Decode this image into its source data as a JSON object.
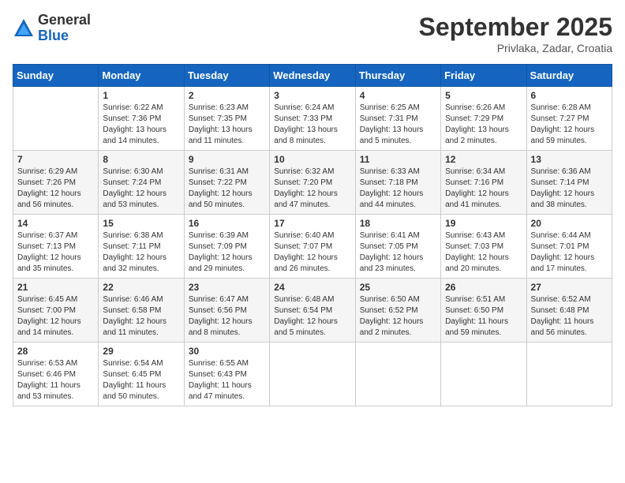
{
  "header": {
    "logo_general": "General",
    "logo_blue": "Blue",
    "month_title": "September 2025",
    "location": "Privlaka, Zadar, Croatia"
  },
  "weekdays": [
    "Sunday",
    "Monday",
    "Tuesday",
    "Wednesday",
    "Thursday",
    "Friday",
    "Saturday"
  ],
  "weeks": [
    [
      {
        "day": "",
        "sunrise": "",
        "sunset": "",
        "daylight": ""
      },
      {
        "day": "1",
        "sunrise": "Sunrise: 6:22 AM",
        "sunset": "Sunset: 7:36 PM",
        "daylight": "Daylight: 13 hours and 14 minutes."
      },
      {
        "day": "2",
        "sunrise": "Sunrise: 6:23 AM",
        "sunset": "Sunset: 7:35 PM",
        "daylight": "Daylight: 13 hours and 11 minutes."
      },
      {
        "day": "3",
        "sunrise": "Sunrise: 6:24 AM",
        "sunset": "Sunset: 7:33 PM",
        "daylight": "Daylight: 13 hours and 8 minutes."
      },
      {
        "day": "4",
        "sunrise": "Sunrise: 6:25 AM",
        "sunset": "Sunset: 7:31 PM",
        "daylight": "Daylight: 13 hours and 5 minutes."
      },
      {
        "day": "5",
        "sunrise": "Sunrise: 6:26 AM",
        "sunset": "Sunset: 7:29 PM",
        "daylight": "Daylight: 13 hours and 2 minutes."
      },
      {
        "day": "6",
        "sunrise": "Sunrise: 6:28 AM",
        "sunset": "Sunset: 7:27 PM",
        "daylight": "Daylight: 12 hours and 59 minutes."
      }
    ],
    [
      {
        "day": "7",
        "sunrise": "Sunrise: 6:29 AM",
        "sunset": "Sunset: 7:26 PM",
        "daylight": "Daylight: 12 hours and 56 minutes."
      },
      {
        "day": "8",
        "sunrise": "Sunrise: 6:30 AM",
        "sunset": "Sunset: 7:24 PM",
        "daylight": "Daylight: 12 hours and 53 minutes."
      },
      {
        "day": "9",
        "sunrise": "Sunrise: 6:31 AM",
        "sunset": "Sunset: 7:22 PM",
        "daylight": "Daylight: 12 hours and 50 minutes."
      },
      {
        "day": "10",
        "sunrise": "Sunrise: 6:32 AM",
        "sunset": "Sunset: 7:20 PM",
        "daylight": "Daylight: 12 hours and 47 minutes."
      },
      {
        "day": "11",
        "sunrise": "Sunrise: 6:33 AM",
        "sunset": "Sunset: 7:18 PM",
        "daylight": "Daylight: 12 hours and 44 minutes."
      },
      {
        "day": "12",
        "sunrise": "Sunrise: 6:34 AM",
        "sunset": "Sunset: 7:16 PM",
        "daylight": "Daylight: 12 hours and 41 minutes."
      },
      {
        "day": "13",
        "sunrise": "Sunrise: 6:36 AM",
        "sunset": "Sunset: 7:14 PM",
        "daylight": "Daylight: 12 hours and 38 minutes."
      }
    ],
    [
      {
        "day": "14",
        "sunrise": "Sunrise: 6:37 AM",
        "sunset": "Sunset: 7:13 PM",
        "daylight": "Daylight: 12 hours and 35 minutes."
      },
      {
        "day": "15",
        "sunrise": "Sunrise: 6:38 AM",
        "sunset": "Sunset: 7:11 PM",
        "daylight": "Daylight: 12 hours and 32 minutes."
      },
      {
        "day": "16",
        "sunrise": "Sunrise: 6:39 AM",
        "sunset": "Sunset: 7:09 PM",
        "daylight": "Daylight: 12 hours and 29 minutes."
      },
      {
        "day": "17",
        "sunrise": "Sunrise: 6:40 AM",
        "sunset": "Sunset: 7:07 PM",
        "daylight": "Daylight: 12 hours and 26 minutes."
      },
      {
        "day": "18",
        "sunrise": "Sunrise: 6:41 AM",
        "sunset": "Sunset: 7:05 PM",
        "daylight": "Daylight: 12 hours and 23 minutes."
      },
      {
        "day": "19",
        "sunrise": "Sunrise: 6:43 AM",
        "sunset": "Sunset: 7:03 PM",
        "daylight": "Daylight: 12 hours and 20 minutes."
      },
      {
        "day": "20",
        "sunrise": "Sunrise: 6:44 AM",
        "sunset": "Sunset: 7:01 PM",
        "daylight": "Daylight: 12 hours and 17 minutes."
      }
    ],
    [
      {
        "day": "21",
        "sunrise": "Sunrise: 6:45 AM",
        "sunset": "Sunset: 7:00 PM",
        "daylight": "Daylight: 12 hours and 14 minutes."
      },
      {
        "day": "22",
        "sunrise": "Sunrise: 6:46 AM",
        "sunset": "Sunset: 6:58 PM",
        "daylight": "Daylight: 12 hours and 11 minutes."
      },
      {
        "day": "23",
        "sunrise": "Sunrise: 6:47 AM",
        "sunset": "Sunset: 6:56 PM",
        "daylight": "Daylight: 12 hours and 8 minutes."
      },
      {
        "day": "24",
        "sunrise": "Sunrise: 6:48 AM",
        "sunset": "Sunset: 6:54 PM",
        "daylight": "Daylight: 12 hours and 5 minutes."
      },
      {
        "day": "25",
        "sunrise": "Sunrise: 6:50 AM",
        "sunset": "Sunset: 6:52 PM",
        "daylight": "Daylight: 12 hours and 2 minutes."
      },
      {
        "day": "26",
        "sunrise": "Sunrise: 6:51 AM",
        "sunset": "Sunset: 6:50 PM",
        "daylight": "Daylight: 11 hours and 59 minutes."
      },
      {
        "day": "27",
        "sunrise": "Sunrise: 6:52 AM",
        "sunset": "Sunset: 6:48 PM",
        "daylight": "Daylight: 11 hours and 56 minutes."
      }
    ],
    [
      {
        "day": "28",
        "sunrise": "Sunrise: 6:53 AM",
        "sunset": "Sunset: 6:46 PM",
        "daylight": "Daylight: 11 hours and 53 minutes."
      },
      {
        "day": "29",
        "sunrise": "Sunrise: 6:54 AM",
        "sunset": "Sunset: 6:45 PM",
        "daylight": "Daylight: 11 hours and 50 minutes."
      },
      {
        "day": "30",
        "sunrise": "Sunrise: 6:55 AM",
        "sunset": "Sunset: 6:43 PM",
        "daylight": "Daylight: 11 hours and 47 minutes."
      },
      {
        "day": "",
        "sunrise": "",
        "sunset": "",
        "daylight": ""
      },
      {
        "day": "",
        "sunrise": "",
        "sunset": "",
        "daylight": ""
      },
      {
        "day": "",
        "sunrise": "",
        "sunset": "",
        "daylight": ""
      },
      {
        "day": "",
        "sunrise": "",
        "sunset": "",
        "daylight": ""
      }
    ]
  ]
}
